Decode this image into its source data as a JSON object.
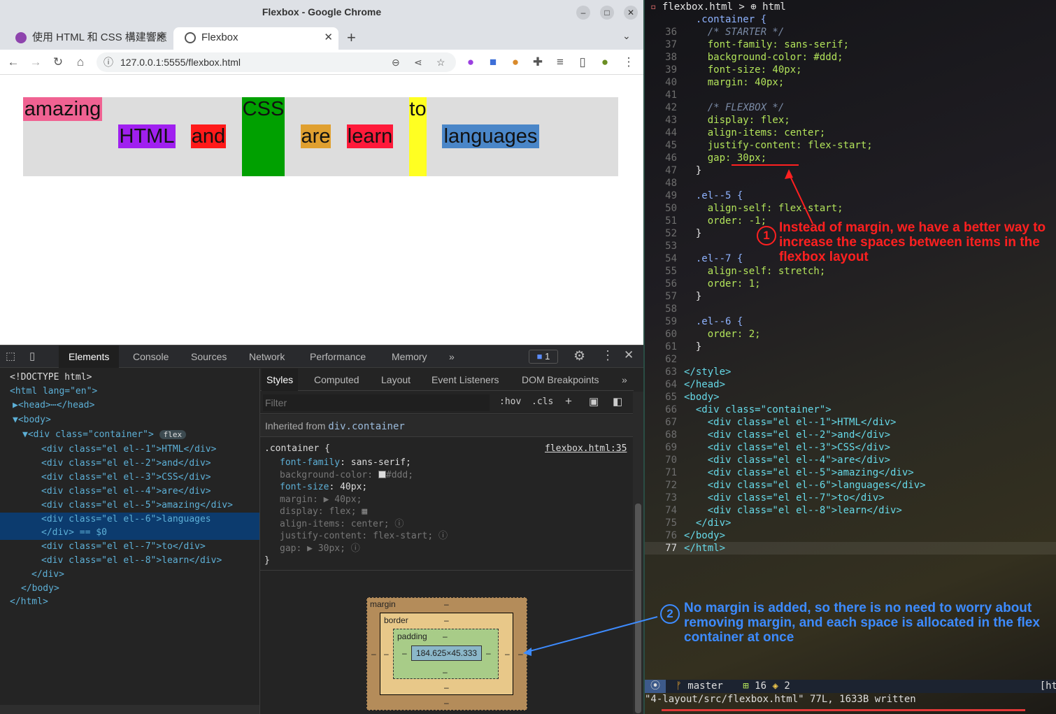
{
  "window": {
    "title": "Flexbox - Google Chrome"
  },
  "tabs": [
    {
      "label": "使用 HTML 和 CSS 構建響應"
    },
    {
      "label": "Flexbox"
    }
  ],
  "address": {
    "url": "127.0.0.1:5555/flexbox.html"
  },
  "demo": [
    {
      "text": "amazing",
      "color": "#f06292"
    },
    {
      "text": "HTML",
      "color": "#a020f0"
    },
    {
      "text": "and",
      "color": "#ff1a1a"
    },
    {
      "text": "CSS",
      "color": "#00a000"
    },
    {
      "text": "are",
      "color": "#e0a030"
    },
    {
      "text": "learn",
      "color": "#ff1a3a"
    },
    {
      "text": "to",
      "color": "#ffff22"
    },
    {
      "text": "languages",
      "color": "#4a86c8"
    }
  ],
  "devtools": {
    "tabs": [
      "Elements",
      "Console",
      "Sources",
      "Network",
      "Performance",
      "Memory",
      "»"
    ],
    "issues": "1",
    "dom": [
      {
        "t": "<!DOCTYPE html>"
      },
      {
        "t": "<html lang=\"en\">"
      },
      {
        "t": "▶<head>⋯</head>"
      },
      {
        "t": "▼<body>"
      },
      {
        "t": "▼<div class=\"container\">",
        "badge": "flex"
      },
      {
        "t": "<div class=\"el el--1\">HTML</div>"
      },
      {
        "t": "<div class=\"el el--2\">and</div>"
      },
      {
        "t": "<div class=\"el el--3\">CSS</div>"
      },
      {
        "t": "<div class=\"el el--4\">are</div>"
      },
      {
        "t": "<div class=\"el el--5\">amazing</div>"
      },
      {
        "t": "<div class=\"el el--6\">languages"
      },
      {
        "t": "</div> == $0"
      },
      {
        "t": "<div class=\"el el--7\">to</div>"
      },
      {
        "t": "<div class=\"el el--8\">learn</div>"
      },
      {
        "t": "</div>"
      },
      {
        "t": "</body>"
      },
      {
        "t": "</html>"
      }
    ],
    "styles_tabs": [
      "Styles",
      "Computed",
      "Layout",
      "Event Listeners",
      "DOM Breakpoints",
      "»"
    ],
    "filter_placeholder": "Filter",
    "hov": ":hov",
    "cls": ".cls",
    "inherited_label": "Inherited from",
    "inherited_from": "div.container",
    "rule_selector": ".container {",
    "rule_source": "flexbox.html:35",
    "rule_close": "}",
    "props": [
      {
        "name": "font-family",
        "value": "sans-serif;"
      },
      {
        "name": "background-color",
        "value": "#ddd;"
      },
      {
        "name": "font-size",
        "value": "40px;"
      },
      {
        "name": "margin",
        "value": "▶ 40px;"
      },
      {
        "name": "display",
        "value": "flex;"
      },
      {
        "name": "align-items",
        "value": "center;"
      },
      {
        "name": "justify-content",
        "value": "flex-start;"
      },
      {
        "name": "gap",
        "value": "▶ 30px;"
      }
    ],
    "boxmodel": {
      "margin": "margin",
      "border": "border",
      "padding": "padding",
      "dash": "–",
      "content": "184.625×45.333"
    }
  },
  "editor": {
    "breadcrumb": "flexbox.html > ⊕ html",
    "lines": [
      {
        "n": "",
        "c": "  .container {"
      },
      {
        "n": "36",
        "c": "    /* STARTER */"
      },
      {
        "n": "37",
        "c": "    font-family: sans-serif;"
      },
      {
        "n": "38",
        "c": "    background-color: #ddd;"
      },
      {
        "n": "39",
        "c": "    font-size: 40px;"
      },
      {
        "n": "40",
        "c": "    margin: 40px;"
      },
      {
        "n": "41",
        "c": ""
      },
      {
        "n": "42",
        "c": "    /* FLEXBOX */"
      },
      {
        "n": "43",
        "c": "    display: flex;"
      },
      {
        "n": "44",
        "c": "    align-items: center;"
      },
      {
        "n": "45",
        "c": "    justify-content: flex-start;"
      },
      {
        "n": "46",
        "c": "    gap: 30px;"
      },
      {
        "n": "47",
        "c": "  }"
      },
      {
        "n": "48",
        "c": ""
      },
      {
        "n": "49",
        "c": "  .el--5 {"
      },
      {
        "n": "50",
        "c": "    align-self: flex-start;"
      },
      {
        "n": "51",
        "c": "    order: -1;"
      },
      {
        "n": "52",
        "c": "  }"
      },
      {
        "n": "53",
        "c": ""
      },
      {
        "n": "54",
        "c": "  .el--7 {"
      },
      {
        "n": "55",
        "c": "    align-self: stretch;"
      },
      {
        "n": "56",
        "c": "    order: 1;"
      },
      {
        "n": "57",
        "c": "  }"
      },
      {
        "n": "58",
        "c": ""
      },
      {
        "n": "59",
        "c": "  .el--6 {"
      },
      {
        "n": "60",
        "c": "    order: 2;"
      },
      {
        "n": "61",
        "c": "  }"
      },
      {
        "n": "62",
        "c": ""
      },
      {
        "n": "63",
        "c": "</style>"
      },
      {
        "n": "64",
        "c": "</head>"
      },
      {
        "n": "65",
        "c": "<body>"
      },
      {
        "n": "66",
        "c": "  <div class=\"container\">"
      },
      {
        "n": "67",
        "c": "    <div class=\"el el--1\">HTML</div>"
      },
      {
        "n": "68",
        "c": "    <div class=\"el el--2\">and</div>"
      },
      {
        "n": "69",
        "c": "    <div class=\"el el--3\">CSS</div>"
      },
      {
        "n": "70",
        "c": "    <div class=\"el el--4\">are</div>"
      },
      {
        "n": "71",
        "c": "    <div class=\"el el--5\">amazing</div>"
      },
      {
        "n": "72",
        "c": "    <div class=\"el el--6\">languages</div>"
      },
      {
        "n": "73",
        "c": "    <div class=\"el el--7\">to</div>"
      },
      {
        "n": "74",
        "c": "    <div class=\"el el--8\">learn</div>"
      },
      {
        "n": "75",
        "c": "  </div>"
      },
      {
        "n": "76",
        "c": "</body>"
      },
      {
        "n": "77",
        "c": "</html>"
      }
    ],
    "annotation1": {
      "num": "1",
      "text": "Instead of margin, we have a better way to increase the spaces between items in the flexbox layout"
    },
    "annotation2": {
      "num": "2",
      "text": "No margin is added, so there is no need to worry about removing margin, and each space is allocated in the flex container at once"
    },
    "status": {
      "mode": "⦿",
      "branch": "master",
      "a": "16",
      "b": "2",
      "right": "[ht"
    },
    "message": "\"4-layout/src/flexbox.html\" 77L, 1633B written"
  },
  "colors": {
    "annotation1": "#ff2020",
    "annotation2": "#3d8bff"
  }
}
